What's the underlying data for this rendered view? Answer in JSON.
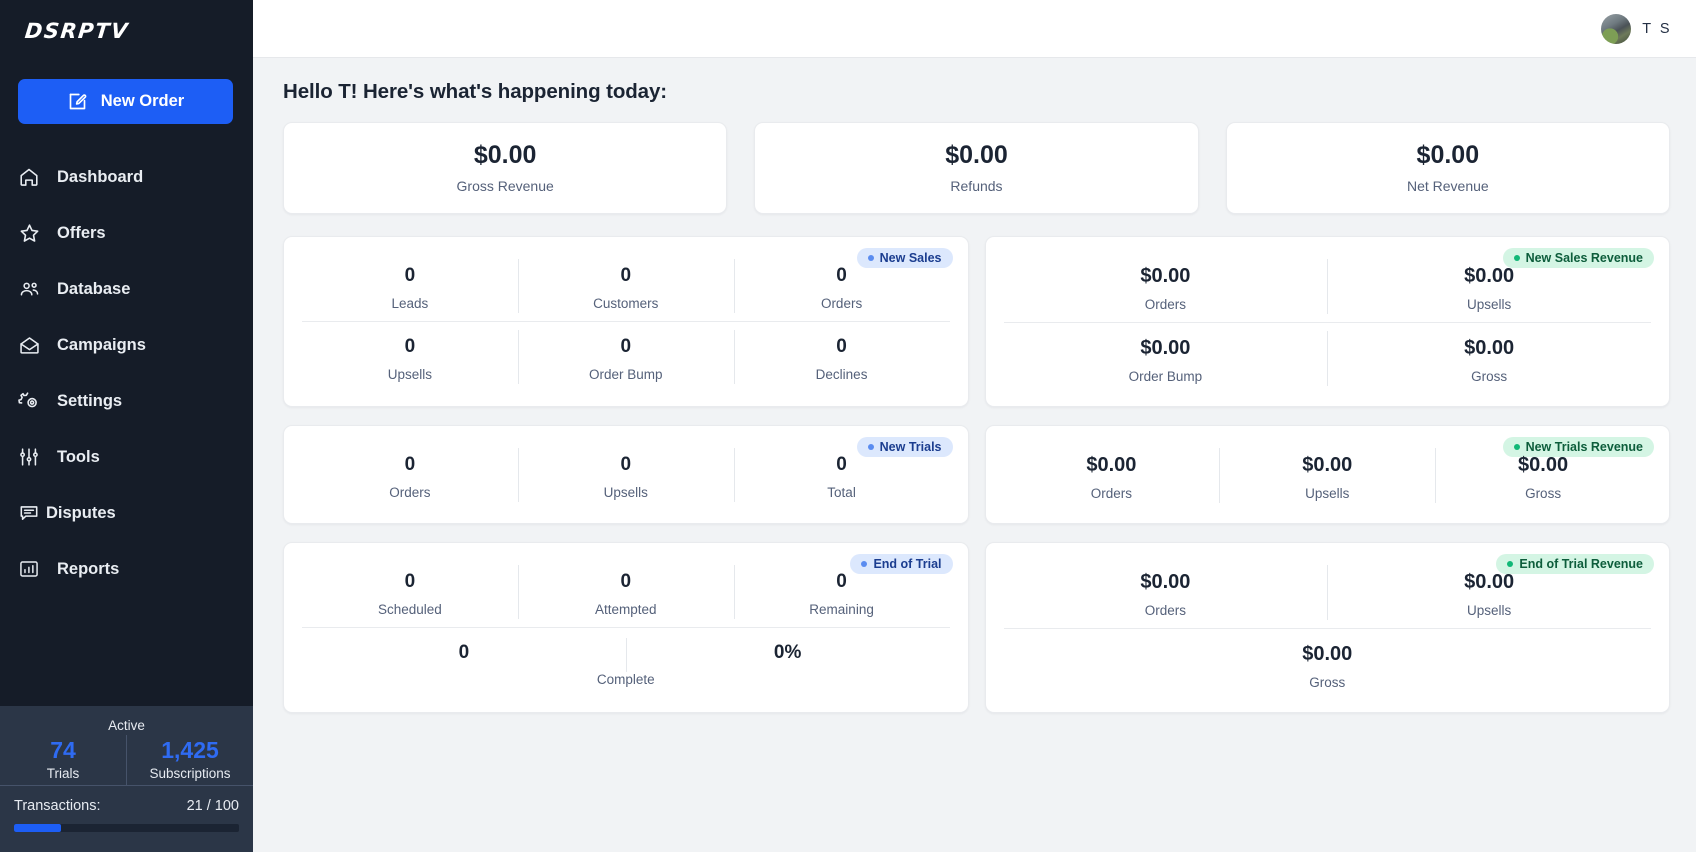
{
  "sidebar": {
    "logo": "DSRPTV",
    "new_order_label": "New Order",
    "nav": [
      {
        "label": "Dashboard",
        "icon": "home-icon"
      },
      {
        "label": "Offers",
        "icon": "star-icon"
      },
      {
        "label": "Database",
        "icon": "people-icon"
      },
      {
        "label": "Campaigns",
        "icon": "envelope-icon"
      },
      {
        "label": "Settings",
        "icon": "gear-icon"
      },
      {
        "label": "Tools",
        "icon": "sliders-icon"
      },
      {
        "label": "Disputes",
        "icon": "chat-icon"
      },
      {
        "label": "Reports",
        "icon": "bar-chart-icon"
      }
    ],
    "active": {
      "title": "Active",
      "trials_value": "74",
      "trials_label": "Trials",
      "subscriptions_value": "1,425",
      "subscriptions_label": "Subscriptions"
    },
    "transactions": {
      "label": "Transactions:",
      "count": "21 / 100",
      "percent": 21
    }
  },
  "topbar": {
    "user_initials": "T S"
  },
  "main": {
    "greeting": "Hello T! Here's what's happening today:",
    "revenue_cards": [
      {
        "value": "$0.00",
        "label": "Gross Revenue"
      },
      {
        "value": "$0.00",
        "label": "Refunds"
      },
      {
        "value": "$0.00",
        "label": "Net Revenue"
      }
    ],
    "new_sales": {
      "badge": "New Sales",
      "row1": [
        {
          "value": "0",
          "label": "Leads"
        },
        {
          "value": "0",
          "label": "Customers"
        },
        {
          "value": "0",
          "label": "Orders"
        }
      ],
      "row2": [
        {
          "value": "0",
          "label": "Upsells"
        },
        {
          "value": "0",
          "label": "Order Bump"
        },
        {
          "value": "0",
          "label": "Declines"
        }
      ]
    },
    "new_sales_revenue": {
      "badge": "New Sales Revenue",
      "row1": [
        {
          "value": "$0.00",
          "label": "Orders"
        },
        {
          "value": "$0.00",
          "label": "Upsells"
        }
      ],
      "row2": [
        {
          "value": "$0.00",
          "label": "Order Bump"
        },
        {
          "value": "$0.00",
          "label": "Gross"
        }
      ]
    },
    "new_trials": {
      "badge": "New Trials",
      "row1": [
        {
          "value": "0",
          "label": "Orders"
        },
        {
          "value": "0",
          "label": "Upsells"
        },
        {
          "value": "0",
          "label": "Total"
        }
      ]
    },
    "new_trials_revenue": {
      "badge": "New Trials Revenue",
      "row1": [
        {
          "value": "$0.00",
          "label": "Orders"
        },
        {
          "value": "$0.00",
          "label": "Upsells"
        },
        {
          "value": "$0.00",
          "label": "Gross"
        }
      ]
    },
    "end_of_trial": {
      "badge": "End of Trial",
      "row1": [
        {
          "value": "0",
          "label": "Scheduled"
        },
        {
          "value": "0",
          "label": "Attempted"
        },
        {
          "value": "0",
          "label": "Remaining"
        }
      ],
      "row2_left_value": "0",
      "row2_right_value": "0%",
      "row2_label": "Complete"
    },
    "end_of_trial_revenue": {
      "badge": "End of Trial Revenue",
      "row1": [
        {
          "value": "$0.00",
          "label": "Orders"
        },
        {
          "value": "$0.00",
          "label": "Upsells"
        }
      ],
      "row2_value": "$0.00",
      "row2_label": "Gross"
    }
  },
  "colors": {
    "accent": "#1d5ef5",
    "sidebar_bg": "#151c28",
    "panel_bg": "#2b3647",
    "badge_blue_bg": "#dce8fd",
    "badge_blue_text": "#1b3d8f",
    "badge_green_bg": "#d4f5e4",
    "badge_green_text": "#0d5d3b"
  }
}
